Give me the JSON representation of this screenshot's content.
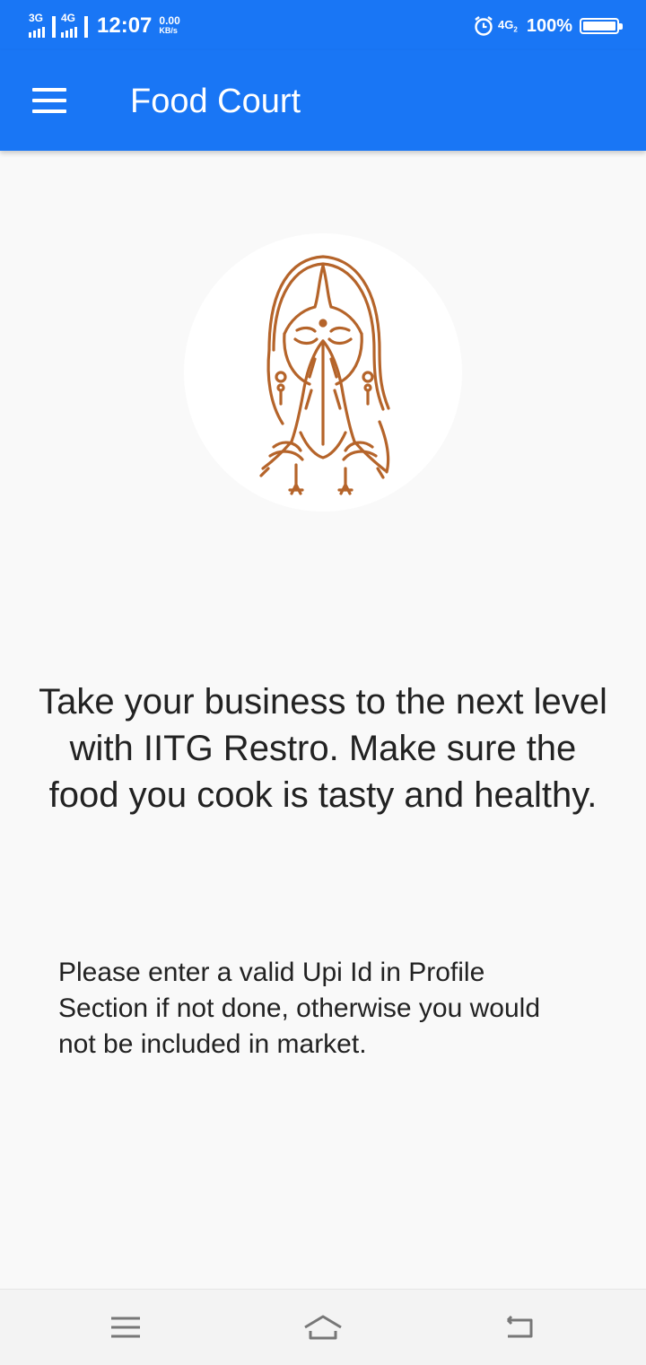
{
  "status_bar": {
    "network_1": "3G",
    "network_2": "4G",
    "time": "12:07",
    "speed_value": "0.00",
    "speed_unit": "KB/s",
    "network_right": "4G",
    "network_right_sub": "2",
    "battery": "100%"
  },
  "app_bar": {
    "title": "Food Court",
    "menu_icon": "hamburger-menu-icon"
  },
  "logo": {
    "icon": "namaste-woman-illustration",
    "color": "#b5642a"
  },
  "main": {
    "headline": "Take your business to the next level with IITG Restro. Make sure the food you cook is tasty and healthy.",
    "notice": "Please enter a valid Upi Id in Profile Section if not done, otherwise you would not be included in market."
  },
  "nav_bar": {
    "recents_icon": "menu-lines-icon",
    "home_icon": "home-icon",
    "back_icon": "back-arrow-icon"
  },
  "colors": {
    "primary": "#1976f5",
    "background": "#f9f9f9",
    "text": "#222222"
  }
}
